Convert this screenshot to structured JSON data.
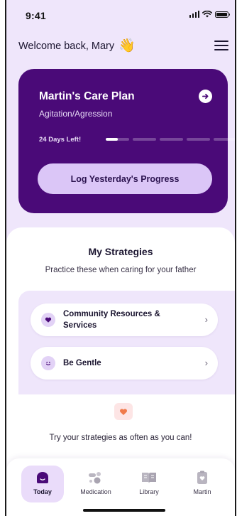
{
  "status_bar": {
    "time": "9:41"
  },
  "header": {
    "welcome_text": "Welcome back, Mary",
    "wave_emoji": "👋",
    "menu_icon": "hamburger-icon"
  },
  "care_plan": {
    "title": "Martin's Care Plan",
    "subtitle": "Agitation/Agression",
    "days_left": "24 Days Left!",
    "progress_segments": [
      0.5,
      0,
      0,
      0,
      0
    ],
    "log_button_label": "Log Yesterday's Progress"
  },
  "strategies": {
    "title": "My Strategies",
    "subtitle": "Practice these when caring for your father",
    "items": [
      {
        "label": "Community Resources & Services",
        "icon": "heart-icon"
      },
      {
        "label": "Be Gentle",
        "icon": "smile-icon"
      }
    ],
    "encouragement": "Try your strategies as often as you can!"
  },
  "nav": {
    "items": [
      {
        "label": "Today",
        "icon": "today-icon",
        "active": true
      },
      {
        "label": "Medication",
        "icon": "pills-icon",
        "active": false
      },
      {
        "label": "Library",
        "icon": "book-icon",
        "active": false
      },
      {
        "label": "Martin",
        "icon": "profile-icon",
        "active": false
      }
    ]
  },
  "colors": {
    "primary": "#4a0a78",
    "accent": "#dbc6f7",
    "background": "#efe6fb"
  }
}
